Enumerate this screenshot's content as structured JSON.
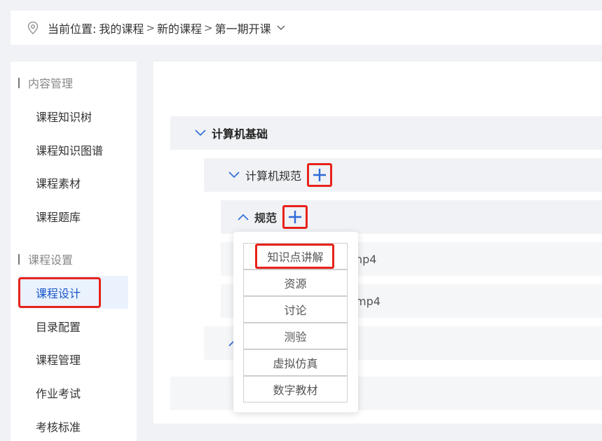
{
  "breadcrumb": {
    "prefix": "当前位置:",
    "items": [
      "我的课程",
      "新的课程",
      "第一期开课"
    ],
    "separator": ">"
  },
  "sidebar": {
    "groups": [
      {
        "title": "内容管理",
        "items": [
          "课程知识树",
          "课程知识图谱",
          "课程素材",
          "课程题库"
        ]
      },
      {
        "title": "课程设置",
        "items": [
          "课程设计",
          "目录配置",
          "课程管理",
          "作业考试",
          "考核标准"
        ]
      }
    ],
    "active_item": "课程设计"
  },
  "tree": {
    "chapter": "计算机基础",
    "section": "计算机规范",
    "subsection": "规范",
    "file_1_suffix": "np4",
    "file_2_suffix": "mp4"
  },
  "dropdown": {
    "items": [
      "知识点讲解",
      "资源",
      "讨论",
      "测验",
      "虚拟仿真",
      "数字教材"
    ]
  },
  "colors": {
    "accent": "#1a56c8",
    "highlight": "#e8221b",
    "active_bg": "#eaf2fe"
  }
}
